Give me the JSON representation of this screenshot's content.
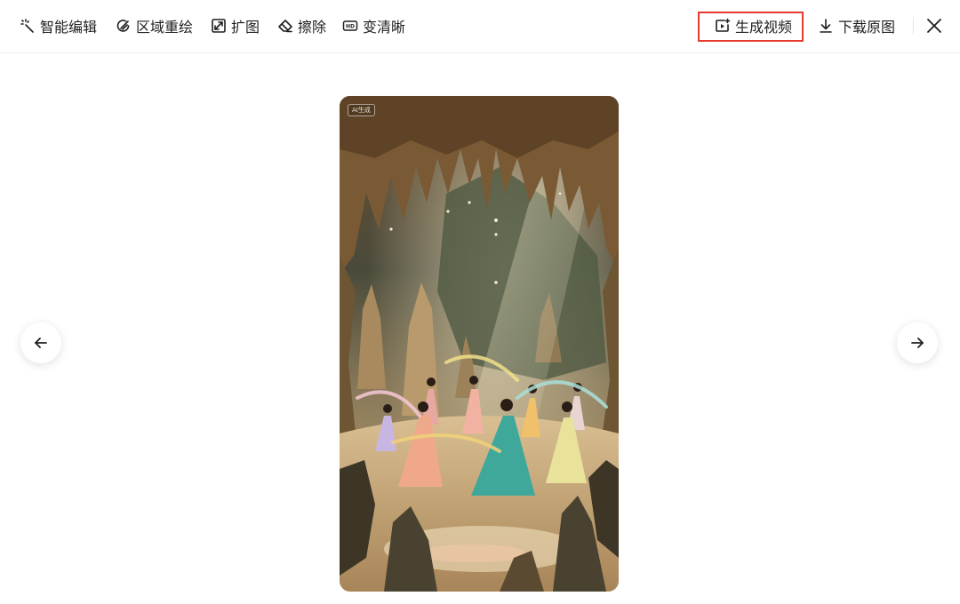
{
  "toolbar": {
    "smart_edit": "智能编辑",
    "region_redraw": "区域重绘",
    "expand": "扩图",
    "erase": "擦除",
    "hd_icon_text": "HD",
    "enhance": "变清晰",
    "generate_video": "生成视频",
    "download_original": "下载原图"
  },
  "image": {
    "badge": "AI生成"
  },
  "icons": {
    "smart_edit": "magic-wand-icon",
    "region_redraw": "brush-circle-icon",
    "expand": "expand-icon",
    "erase": "eraser-icon",
    "enhance": "hd-icon",
    "generate_video": "video-add-icon",
    "download_original": "download-icon",
    "close": "close-icon",
    "prev": "arrow-left-icon",
    "next": "arrow-right-icon"
  },
  "colors": {
    "highlight": "#e53a2f",
    "text": "#1f1f1f"
  }
}
